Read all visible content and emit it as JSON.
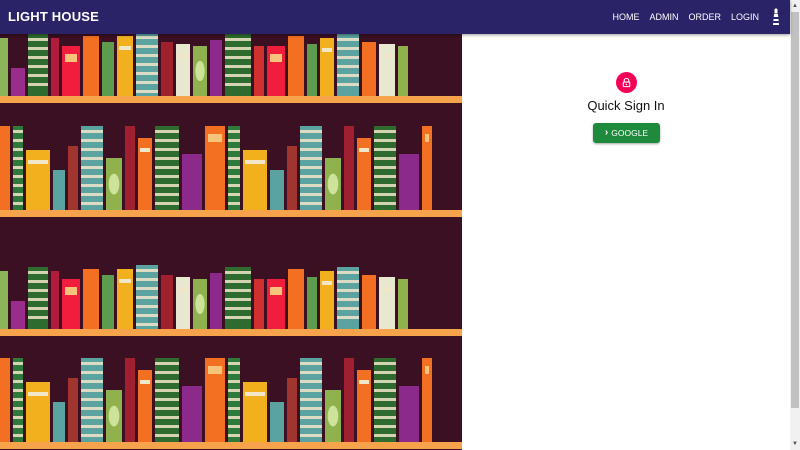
{
  "header": {
    "brand": "LIGHT HOUSE",
    "nav": [
      {
        "label": "HOME"
      },
      {
        "label": "ADMIN"
      },
      {
        "label": "ORDER"
      },
      {
        "label": "LOGIN"
      }
    ]
  },
  "signin": {
    "title": "Quick Sign In",
    "google_label": "GOOGLE"
  },
  "colors": {
    "appbar": "#2a2367",
    "avatar": "#f50057",
    "google_button": "#1e8a3c",
    "shelf_background": "#3a1022",
    "shelf_plank": "#f6a34b"
  },
  "icons": {
    "lighthouse": "lighthouse-icon",
    "lock": "lock-icon",
    "chevron": "chevron-right-icon"
  }
}
